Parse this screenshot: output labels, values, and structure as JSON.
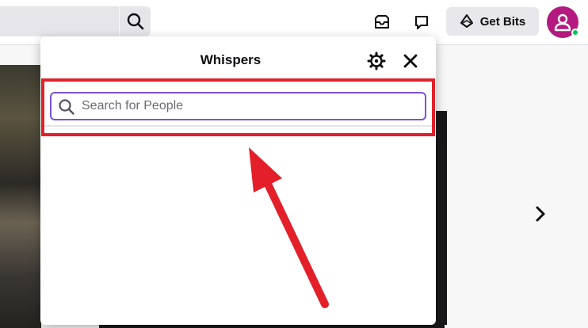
{
  "topnav": {
    "get_bits_label": "Get Bits"
  },
  "whispers": {
    "title": "Whispers",
    "search": {
      "value": "",
      "placeholder": "Search for People"
    }
  },
  "colors": {
    "accent": "#7c52d6",
    "avatar": "#b3197e",
    "online": "#00c853",
    "annotation": "#e3202a"
  },
  "icons": [
    "search-icon",
    "inbox-icon",
    "whisper-icon",
    "bits-icon",
    "settings-icon",
    "close-icon",
    "chevron-right-icon",
    "user-icon"
  ]
}
